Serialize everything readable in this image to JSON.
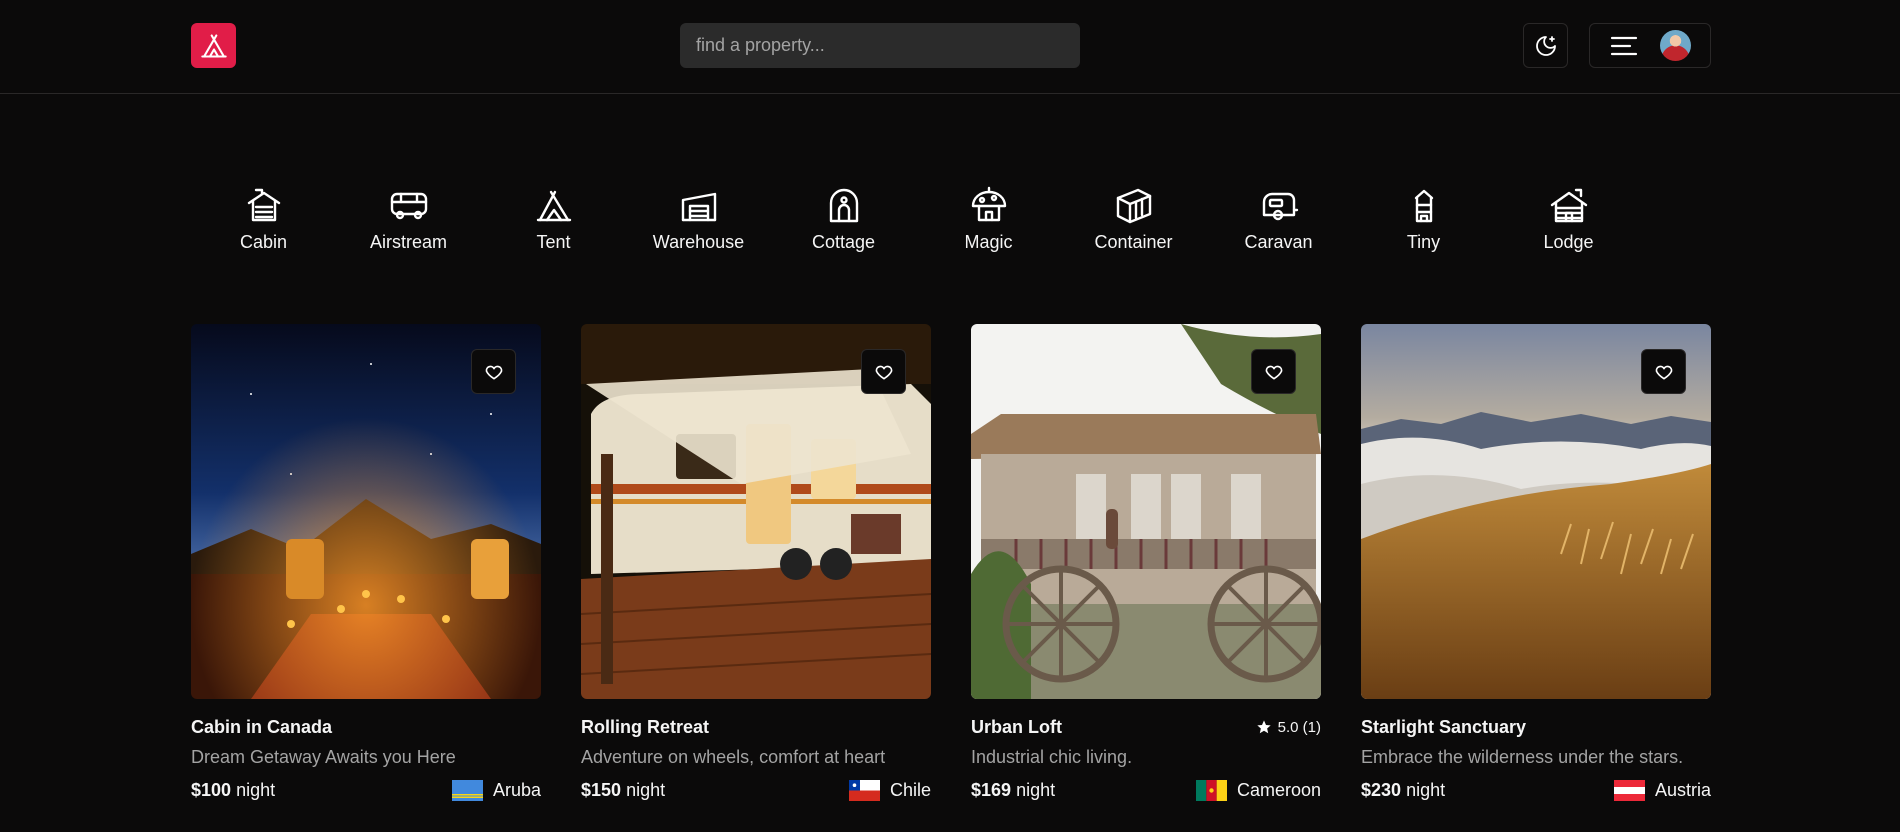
{
  "header": {
    "logo_icon": "tent-icon",
    "search_placeholder": "find a property...",
    "theme_icon": "moon-icon",
    "menu_icon": "menu-icon",
    "accent_color": "#e11d48"
  },
  "categories": [
    {
      "label": "Cabin",
      "icon": "cabin-icon"
    },
    {
      "label": "Airstream",
      "icon": "airstream-icon"
    },
    {
      "label": "Tent",
      "icon": "tent-icon"
    },
    {
      "label": "Warehouse",
      "icon": "warehouse-icon"
    },
    {
      "label": "Cottage",
      "icon": "cottage-icon"
    },
    {
      "label": "Magic",
      "icon": "magic-icon"
    },
    {
      "label": "Container",
      "icon": "container-icon"
    },
    {
      "label": "Caravan",
      "icon": "caravan-icon"
    },
    {
      "label": "Tiny",
      "icon": "tiny-icon"
    },
    {
      "label": "Lodge",
      "icon": "lodge-icon"
    }
  ],
  "listings": [
    {
      "name": "Cabin in Canada",
      "tagline": "Dream Getaway Awaits you Here",
      "price": "$100",
      "unit": "night",
      "country": "Aruba",
      "rating": "",
      "flag": "flag-aruba-icon"
    },
    {
      "name": "Rolling Retreat",
      "tagline": "Adventure on wheels, comfort at heart",
      "price": "$150",
      "unit": "night",
      "country": "Chile",
      "rating": "",
      "flag": "flag-chile-icon"
    },
    {
      "name": "Urban Loft",
      "tagline": "Industrial chic living.",
      "price": "$169",
      "unit": "night",
      "country": "Cameroon",
      "rating": "5.0 (1)",
      "flag": "flag-cameroon-icon"
    },
    {
      "name": "Starlight Sanctuary",
      "tagline": "Embrace the wilderness under the stars.",
      "price": "$230",
      "unit": "night",
      "country": "Austria",
      "rating": "",
      "flag": "flag-austria-icon"
    }
  ]
}
